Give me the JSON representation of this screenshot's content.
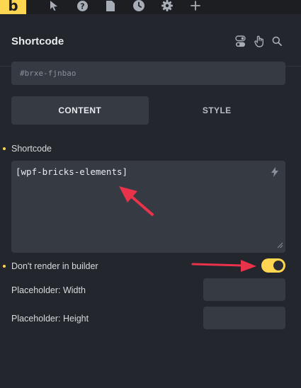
{
  "toolbar": {
    "logo": "b",
    "icons": [
      "pointer-icon",
      "help-icon",
      "page-icon",
      "history-icon",
      "settings-icon",
      "add-icon"
    ]
  },
  "panel": {
    "title": "Shortcode",
    "header_icons": [
      "toggle-switch-icon",
      "hand-pointer-icon",
      "search-icon"
    ]
  },
  "element_id": "#brxe-fjnbao",
  "tabs": [
    {
      "label": "CONTENT",
      "active": true
    },
    {
      "label": "STYLE",
      "active": false
    }
  ],
  "fields": {
    "shortcode_label": "Shortcode",
    "shortcode_value": "[wpf-bricks-elements]",
    "dont_render_label": "Don't render in builder",
    "dont_render_on": true,
    "placeholder_width_label": "Placeholder: Width",
    "placeholder_width_value": "",
    "placeholder_height_label": "Placeholder: Height",
    "placeholder_height_value": ""
  },
  "colors": {
    "accent": "#ffd64f",
    "background": "#23262c",
    "input_bg": "#363a43",
    "annotation_arrow": "#e8334a"
  }
}
